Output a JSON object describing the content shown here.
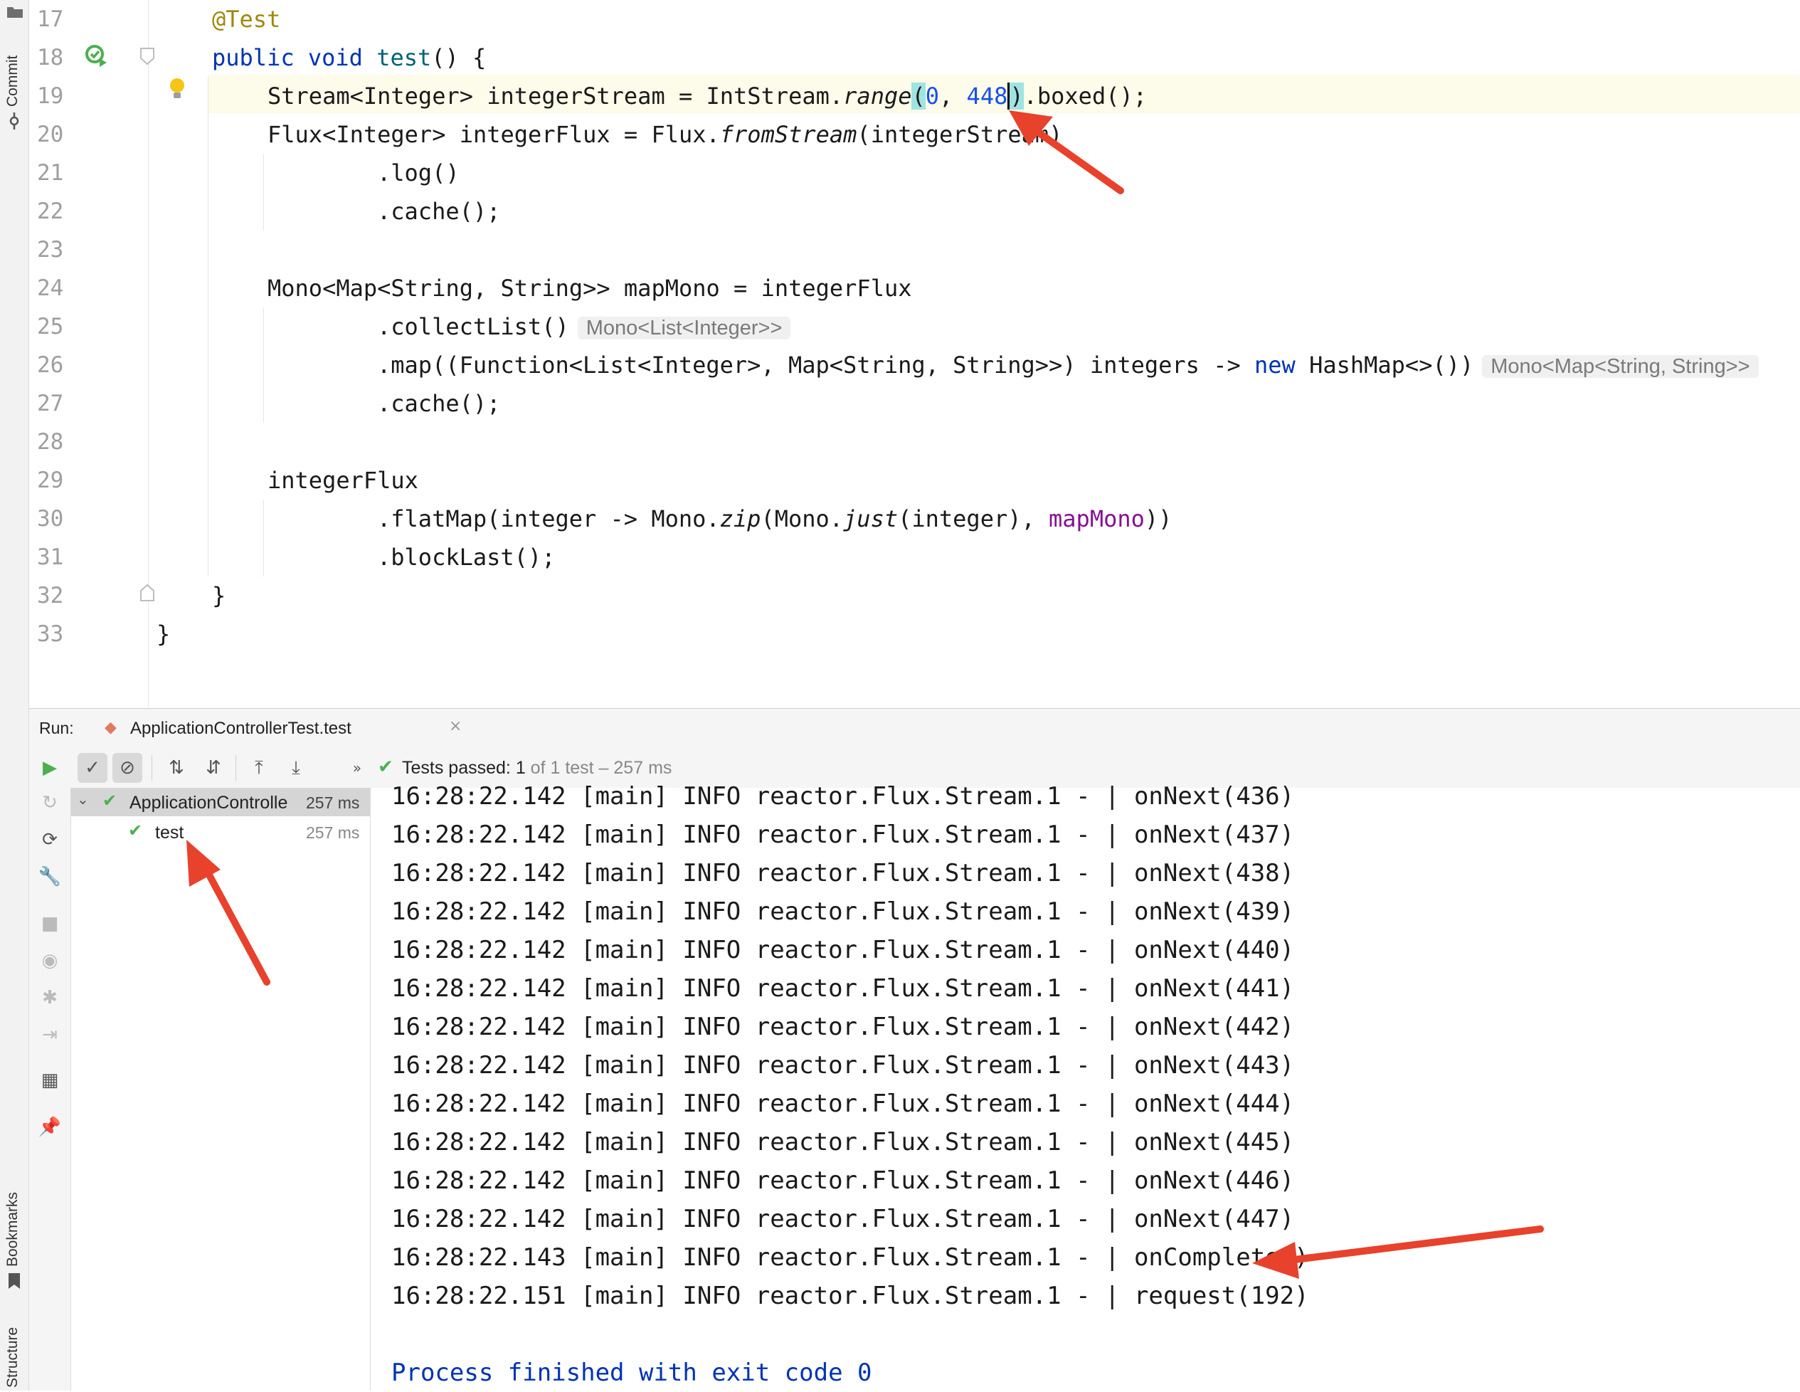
{
  "left_strip": {
    "top_label": "Commit",
    "bottom_labels": [
      "Bookmarks",
      "Structure"
    ]
  },
  "editor": {
    "lines": [
      {
        "num": "17"
      },
      {
        "num": "18"
      },
      {
        "num": "19"
      },
      {
        "num": "20"
      },
      {
        "num": "21"
      },
      {
        "num": "22"
      },
      {
        "num": "23"
      },
      {
        "num": "24"
      },
      {
        "num": "25"
      },
      {
        "num": "26"
      },
      {
        "num": "27"
      },
      {
        "num": "28"
      },
      {
        "num": "29"
      },
      {
        "num": "30"
      },
      {
        "num": "31"
      },
      {
        "num": "32"
      },
      {
        "num": "33"
      }
    ],
    "code": {
      "l17": "@Test",
      "l18_kw": "public void",
      "l18_fn": "test",
      "l18_rest": "() {",
      "l19_a": "Stream<Integer> integerStream = IntStream.",
      "l19_range": "range",
      "l19_open": "(",
      "l19_zero": "0",
      "l19_comma": ", ",
      "l19_num": "448",
      "l19_close": ")",
      "l19_rest": ".boxed();",
      "l20_a": "Flux<Integer> integerFlux = Flux.",
      "l20_from": "fromStream",
      "l20_rest": "(integerStream)",
      "l21": ".log()",
      "l22": ".cache();",
      "l24": "Mono<Map<String, String>> mapMono = integerFlux",
      "l25": ".collectList()",
      "l25_hint": "Mono<List<Integer>>",
      "l26_a": ".map((Function<List<Integer>, Map<String, String>>) integers -> ",
      "l26_kw": "new",
      "l26_b": " HashMap<>())",
      "l26_hint": "Mono<Map<String, String>>",
      "l27": ".cache();",
      "l29": "integerFlux",
      "l30_a": ".flatMap(integer -> Mono.",
      "l30_zip": "zip",
      "l30_b": "(Mono.",
      "l30_just": "just",
      "l30_c": "(integer), ",
      "l30_map": "mapMono",
      "l30_d": "))",
      "l31": ".blockLast();",
      "l32": "}",
      "l33": "}"
    }
  },
  "run_panel": {
    "run_label": "Run:",
    "tab_title": "ApplicationControllerTest.test",
    "status_prefix": "Tests passed:",
    "status_count": "1",
    "status_suffix": "of 1 test – 257 ms",
    "tree": {
      "root_label": "ApplicationControlle",
      "root_time": "257 ms",
      "child_label": "test",
      "child_time": "257 ms"
    },
    "console_lines": [
      "16:28:22.142 [main] INFO reactor.Flux.Stream.1 - | onNext(436)",
      "16:28:22.142 [main] INFO reactor.Flux.Stream.1 - | onNext(437)",
      "16:28:22.142 [main] INFO reactor.Flux.Stream.1 - | onNext(438)",
      "16:28:22.142 [main] INFO reactor.Flux.Stream.1 - | onNext(439)",
      "16:28:22.142 [main] INFO reactor.Flux.Stream.1 - | onNext(440)",
      "16:28:22.142 [main] INFO reactor.Flux.Stream.1 - | onNext(441)",
      "16:28:22.142 [main] INFO reactor.Flux.Stream.1 - | onNext(442)",
      "16:28:22.142 [main] INFO reactor.Flux.Stream.1 - | onNext(443)",
      "16:28:22.142 [main] INFO reactor.Flux.Stream.1 - | onNext(444)",
      "16:28:22.142 [main] INFO reactor.Flux.Stream.1 - | onNext(445)",
      "16:28:22.142 [main] INFO reactor.Flux.Stream.1 - | onNext(446)",
      "16:28:22.142 [main] INFO reactor.Flux.Stream.1 - | onNext(447)",
      "16:28:22.143 [main] INFO reactor.Flux.Stream.1 - | onComplete()",
      "16:28:22.151 [main] INFO reactor.Flux.Stream.1 - | request(192)"
    ],
    "process_line": "Process finished with exit code 0"
  },
  "colors": {
    "keyword": "#0033b3",
    "annotation": "#9e880d",
    "number": "#1750eb",
    "pass_green": "#4caf50",
    "arrow_red": "#e8412c"
  }
}
